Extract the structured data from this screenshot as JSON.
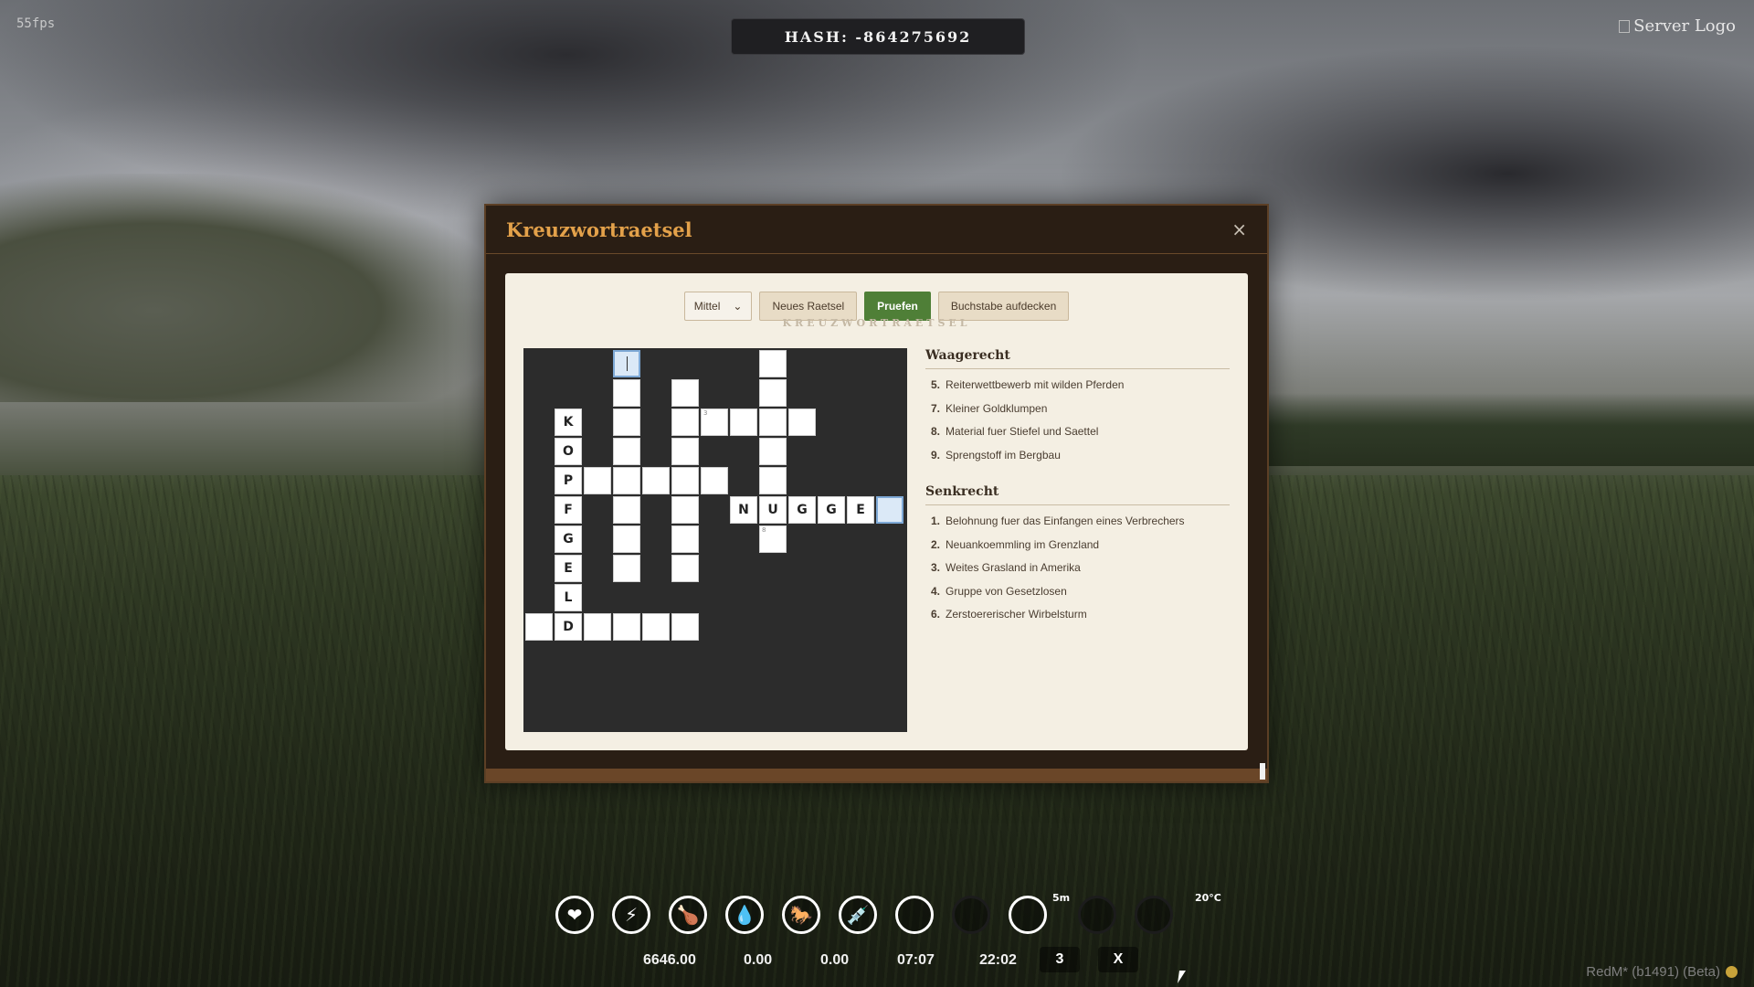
{
  "fps": "55fps",
  "hash": "HASH: -864275692",
  "server_logo_alt": "Server Logo",
  "modal": {
    "title": "Kreuzwortraetsel",
    "close": "×",
    "difficulty": "Mittel",
    "new_puzzle": "Neues Raetsel",
    "check": "Pruefen",
    "reveal": "Buchstabe aufdecken",
    "watermark": "KREUZWORTRAETSEL"
  },
  "grid": {
    "cells": [
      {
        "row": 0,
        "col": 3,
        "letter": "",
        "active": true
      },
      {
        "row": 0,
        "col": 8,
        "letter": ""
      },
      {
        "row": 1,
        "col": 3,
        "letter": ""
      },
      {
        "row": 1,
        "col": 5,
        "letter": ""
      },
      {
        "row": 1,
        "col": 8,
        "letter": ""
      },
      {
        "row": 2,
        "col": 1,
        "letter": "K"
      },
      {
        "row": 2,
        "col": 3,
        "letter": ""
      },
      {
        "row": 2,
        "col": 5,
        "letter": ""
      },
      {
        "row": 2,
        "col": 6,
        "letter": "",
        "num": "3"
      },
      {
        "row": 2,
        "col": 7,
        "letter": ""
      },
      {
        "row": 2,
        "col": 8,
        "letter": ""
      },
      {
        "row": 2,
        "col": 9,
        "letter": ""
      },
      {
        "row": 3,
        "col": 1,
        "letter": "O"
      },
      {
        "row": 3,
        "col": 3,
        "letter": ""
      },
      {
        "row": 3,
        "col": 5,
        "letter": ""
      },
      {
        "row": 3,
        "col": 8,
        "letter": ""
      },
      {
        "row": 4,
        "col": 1,
        "letter": "P"
      },
      {
        "row": 4,
        "col": 2,
        "letter": ""
      },
      {
        "row": 4,
        "col": 3,
        "letter": ""
      },
      {
        "row": 4,
        "col": 4,
        "letter": ""
      },
      {
        "row": 4,
        "col": 5,
        "letter": ""
      },
      {
        "row": 4,
        "col": 6,
        "letter": ""
      },
      {
        "row": 4,
        "col": 8,
        "letter": ""
      },
      {
        "row": 5,
        "col": 1,
        "letter": "F"
      },
      {
        "row": 5,
        "col": 3,
        "letter": ""
      },
      {
        "row": 5,
        "col": 5,
        "letter": ""
      },
      {
        "row": 5,
        "col": 7,
        "letter": "N"
      },
      {
        "row": 5,
        "col": 8,
        "letter": "U"
      },
      {
        "row": 5,
        "col": 9,
        "letter": "G"
      },
      {
        "row": 5,
        "col": 10,
        "letter": "G"
      },
      {
        "row": 5,
        "col": 11,
        "letter": "E"
      },
      {
        "row": 5,
        "col": 12,
        "letter": "",
        "active": true
      },
      {
        "row": 6,
        "col": 1,
        "letter": "G"
      },
      {
        "row": 6,
        "col": 3,
        "letter": ""
      },
      {
        "row": 6,
        "col": 5,
        "letter": ""
      },
      {
        "row": 6,
        "col": 8,
        "letter": "",
        "num": "8"
      },
      {
        "row": 7,
        "col": 1,
        "letter": "E"
      },
      {
        "row": 7,
        "col": 3,
        "letter": ""
      },
      {
        "row": 7,
        "col": 5,
        "letter": ""
      },
      {
        "row": 8,
        "col": 1,
        "letter": "L"
      },
      {
        "row": 9,
        "col": 0,
        "letter": ""
      },
      {
        "row": 9,
        "col": 1,
        "letter": "D"
      },
      {
        "row": 9,
        "col": 2,
        "letter": ""
      },
      {
        "row": 9,
        "col": 3,
        "letter": ""
      },
      {
        "row": 9,
        "col": 4,
        "letter": ""
      },
      {
        "row": 9,
        "col": 5,
        "letter": ""
      }
    ]
  },
  "clues": {
    "across_title": "Waagerecht",
    "across": [
      {
        "num": "5.",
        "text": "Reiterwettbewerb mit wilden Pferden"
      },
      {
        "num": "7.",
        "text": "Kleiner Goldklumpen"
      },
      {
        "num": "8.",
        "text": "Material fuer Stiefel und Saettel"
      },
      {
        "num": "9.",
        "text": "Sprengstoff im Bergbau"
      }
    ],
    "down_title": "Senkrecht",
    "down": [
      {
        "num": "1.",
        "text": "Belohnung fuer das Einfangen eines Verbrechers"
      },
      {
        "num": "2.",
        "text": "Neuankoemmling im Grenzland"
      },
      {
        "num": "3.",
        "text": "Weites Grasland in Amerika"
      },
      {
        "num": "4.",
        "text": "Gruppe von Gesetzlosen"
      },
      {
        "num": "6.",
        "text": "Zerstoererischer Wirbelsturm"
      }
    ]
  },
  "hud": {
    "icons": [
      {
        "name": "heart-icon",
        "glyph": "❤"
      },
      {
        "name": "stamina-icon",
        "glyph": "⚡"
      },
      {
        "name": "food-icon",
        "glyph": "🍗"
      },
      {
        "name": "water-icon",
        "glyph": "💧"
      },
      {
        "name": "horse-icon",
        "glyph": "🐎"
      },
      {
        "name": "syringe-icon",
        "glyph": "💉"
      },
      {
        "name": "empty-ring-icon",
        "glyph": ""
      },
      {
        "name": "dark-ring-icon",
        "glyph": "",
        "dim": true
      },
      {
        "name": "timer-ring-icon",
        "glyph": ""
      },
      {
        "name": "compass-icon",
        "glyph": "",
        "dim": true
      },
      {
        "name": "temperature-icon",
        "glyph": "",
        "dim": true
      }
    ],
    "money": "6646.00",
    "val2": "0.00",
    "val3": "0.00",
    "time1": "07:07",
    "time2": "22:02",
    "count": "3",
    "close_x": "X",
    "timer_label": "5m",
    "temperature": "20°C"
  },
  "footer_brand": "RedM* (b1491) (Beta)"
}
